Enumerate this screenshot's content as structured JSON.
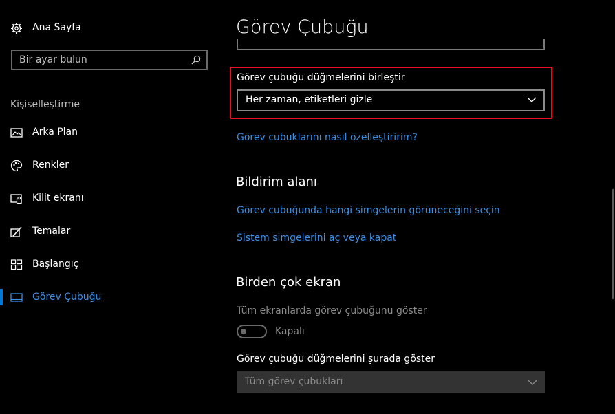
{
  "sidebar": {
    "home_label": "Ana Sayfa",
    "search_placeholder": "Bir ayar bulun",
    "section_title": "Kişiselleştirme",
    "items": [
      {
        "label": "Arka Plan",
        "icon": "picture-icon"
      },
      {
        "label": "Renkler",
        "icon": "palette-icon"
      },
      {
        "label": "Kilit ekranı",
        "icon": "lock-screen-icon"
      },
      {
        "label": "Temalar",
        "icon": "themes-icon"
      },
      {
        "label": "Başlangıç",
        "icon": "start-icon"
      },
      {
        "label": "Görev Çubuğu",
        "icon": "taskbar-icon",
        "selected": true
      }
    ],
    "accent_color": "#0078d7"
  },
  "main": {
    "title": "Görev Çubuğu",
    "combine": {
      "label": "Görev çubuğu düğmelerini birleştir",
      "value": "Her zaman, etiketleri gizle",
      "highlight_color": "#e81123"
    },
    "customize_link": "Görev çubuklarını nasıl özelleştiririm?",
    "notification": {
      "title": "Bildirim alanı",
      "links": [
        "Görev çubuğunda hangi simgelerin görüneceğini seçin",
        "Sistem simgelerini aç veya kapat"
      ]
    },
    "multi_display": {
      "title": "Birden çok ekran",
      "toggle_label": "Tüm ekranlarda görev çubuğunu göster",
      "toggle_state": "Kapalı",
      "show_buttons_label": "Görev çubuğu düğmelerini şurada göster",
      "show_buttons_value": "Tüm görev çubukları"
    }
  },
  "colors": {
    "link": "#3a8ee6",
    "background": "#000000"
  }
}
